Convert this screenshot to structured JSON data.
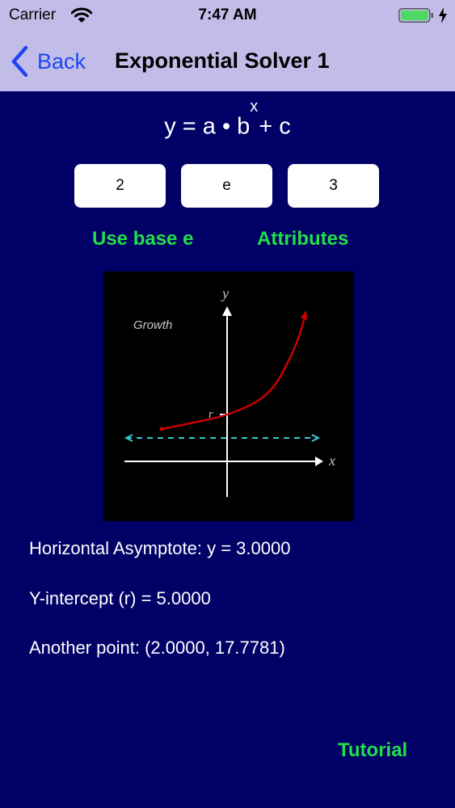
{
  "status_bar": {
    "carrier": "Carrier",
    "time": "7:47 AM",
    "battery_color": "#4cd964"
  },
  "nav": {
    "back_label": "Back",
    "title": "Exponential Solver 1"
  },
  "formula": {
    "base": "y = a • b",
    "exponent": "x",
    "tail": "+ c"
  },
  "inputs": {
    "a": "2",
    "b": "e",
    "c": "3"
  },
  "actions": {
    "use_base_e": "Use base e",
    "attributes": "Attributes",
    "tutorial": "Tutorial"
  },
  "graph": {
    "caption": "Growth",
    "x_label": "x",
    "y_label": "y",
    "intercept_label": "r",
    "curve_color": "#cc0000",
    "asymptote_color": "#36c7d6"
  },
  "results": {
    "asymptote": "Horizontal Asymptote: y = 3.0000",
    "intercept": "Y-intercept (r) = 5.0000",
    "point": "Another point: (2.0000, 17.7781)"
  },
  "colors": {
    "background": "#000066",
    "header": "#c2bde8",
    "accent_green": "#21e04a",
    "back_blue": "#1d46f2"
  }
}
